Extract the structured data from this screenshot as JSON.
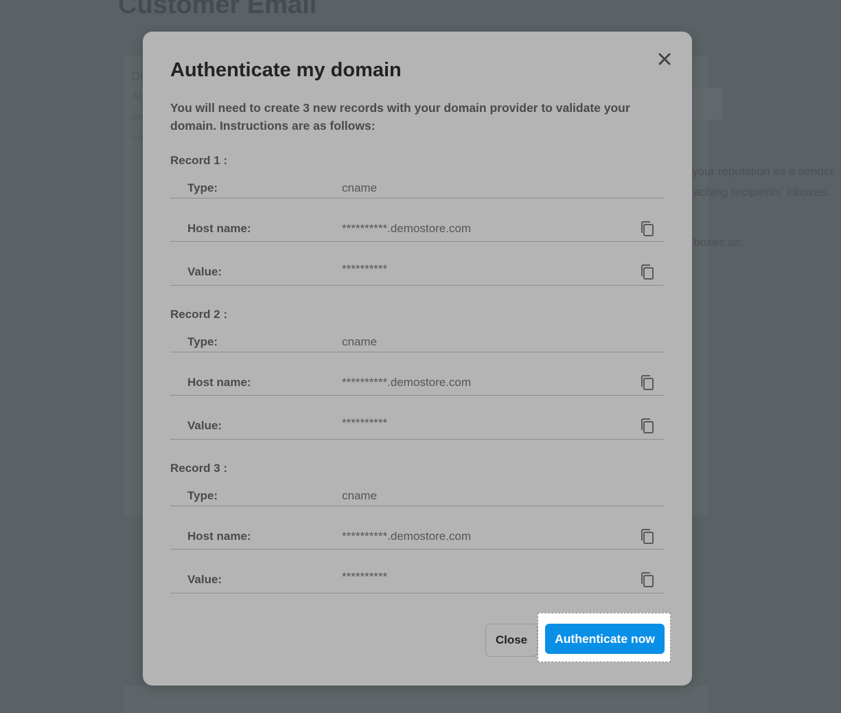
{
  "background": {
    "page_title": "Customer Email",
    "card_heading_partial": "Do",
    "left_fragments": [
      "Au",
      "en",
      "co"
    ],
    "right_fragments": [
      "your reputation as a sender",
      "aching recipients' inboxes.",
      "boxes as:"
    ]
  },
  "modal": {
    "title": "Authenticate my domain",
    "description": "You will need to create 3 new records with your domain provider to validate your domain. Instructions are as follows:",
    "close_icon": "close-icon",
    "records": [
      {
        "title": "Record 1 :",
        "type_label": "Type:",
        "type_value": "cname",
        "host_label": "Host name:",
        "host_value": "**********.demostore.com",
        "value_label": "Value:",
        "value_value": "**********"
      },
      {
        "title": "Record 2 :",
        "type_label": "Type:",
        "type_value": "cname",
        "host_label": "Host name:",
        "host_value": "**********.demostore.com",
        "value_label": "Value:",
        "value_value": "**********"
      },
      {
        "title": "Record 3 :",
        "type_label": "Type:",
        "type_value": "cname",
        "host_label": "Host name:",
        "host_value": "**********.demostore.com",
        "value_label": "Value:",
        "value_value": "**********"
      }
    ],
    "buttons": {
      "close_label": "Close",
      "primary_label": "Authenticate now"
    },
    "colors": {
      "primary": "#0a8fe7",
      "overlay": "#5b6266",
      "modal_bg": "#b4b4b4"
    }
  }
}
